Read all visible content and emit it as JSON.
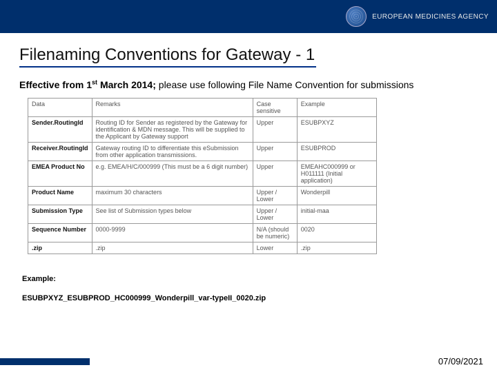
{
  "brand": "EUROPEAN MEDICINES AGENCY",
  "title": "Filenaming Conventions for Gateway - 1",
  "intro_bold_prefix": "Effective from 1",
  "intro_sup": "st",
  "intro_bold_suffix": " March 2014;",
  "intro_rest": " please use following File Name Convention for submissions",
  "headers": {
    "c1": "Data",
    "c2": "Remarks",
    "c3": "Case sensitive",
    "c4": "Example"
  },
  "rows": [
    {
      "c1": "Sender.RoutingId",
      "c2": "Routing ID for Sender as registered by the Gateway for identification & MDN message. This will be supplied to the Applicant by Gateway support",
      "c3": "Upper",
      "c4": "ESUBPXYZ"
    },
    {
      "c1": "Receiver.RoutingId",
      "c2": "Gateway routing ID to differentiate this eSubmission from other application transmissions.",
      "c3": "Upper",
      "c4": "ESUBPROD"
    },
    {
      "c1": "EMEA Product No",
      "c2": "e.g. EMEA/H/C/000999 (This must be a 6 digit number)",
      "c3": "Upper",
      "c4": "EMEAHC000999 or H011111 (Initial application)"
    },
    {
      "c1": "Product Name",
      "c2": "maximum 30 characters",
      "c3": "Upper / Lower",
      "c4": "Wonderpill"
    },
    {
      "c1": "Submission Type",
      "c2": "See list of Submission types below",
      "c3": "Upper / Lower",
      "c4": "initial-maa"
    },
    {
      "c1": "Sequence Number",
      "c2": "0000-9999",
      "c3": "N/A (should be numeric)",
      "c4": "0020"
    },
    {
      "c1": ".zip",
      "c2": ".zip",
      "c3": "Lower",
      "c4": ".zip"
    }
  ],
  "example_label": "Example:",
  "example_value": "ESUBPXYZ_ESUBPROD_HC000999_Wonderpill_var-typeII_0020.zip",
  "date": "07/09/2021"
}
